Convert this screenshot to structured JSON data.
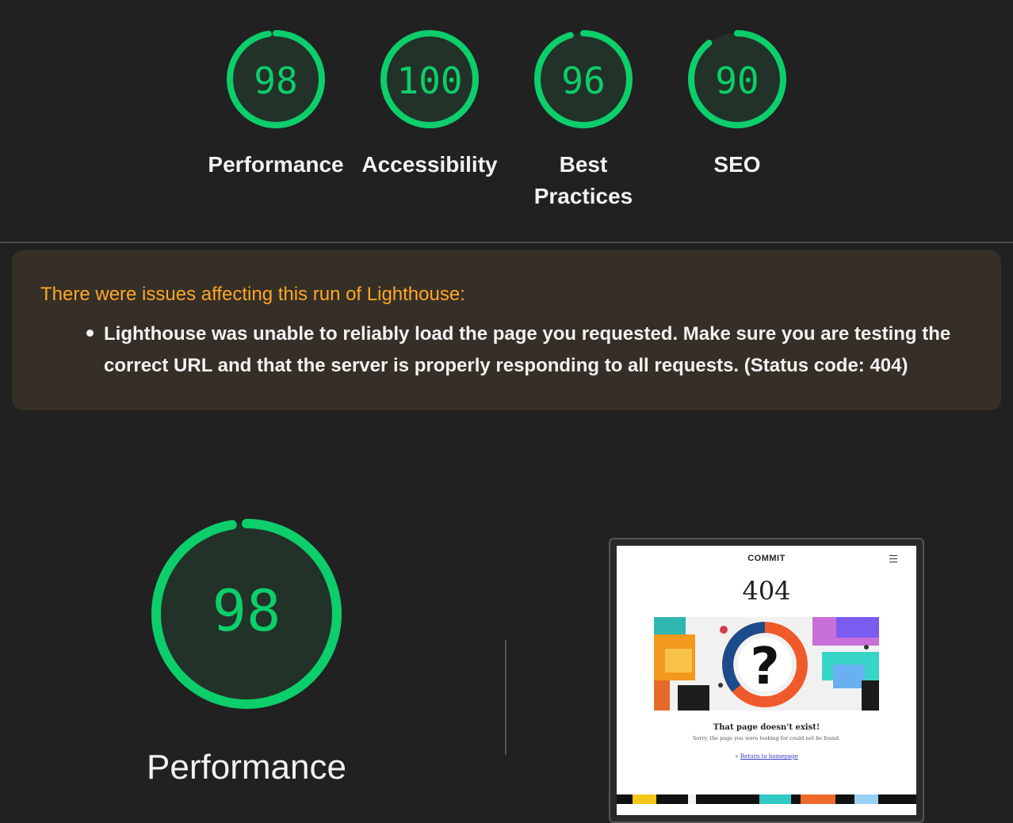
{
  "colors": {
    "pass": "#0cce6b",
    "pass_fill": "#233228",
    "warning": "#ffa726",
    "background": "#212121"
  },
  "gauges": [
    {
      "score": "98",
      "value": 98,
      "label_lines": [
        "Performance"
      ]
    },
    {
      "score": "100",
      "value": 100,
      "label_lines": [
        "Accessibility"
      ]
    },
    {
      "score": "96",
      "value": 96,
      "label_lines": [
        "Best",
        "Practices"
      ]
    },
    {
      "score": "90",
      "value": 90,
      "label_lines": [
        "SEO"
      ]
    }
  ],
  "warning": {
    "title": "There were issues affecting this run of Lighthouse:",
    "items": [
      "Lighthouse was unable to reliably load the page you requested. Make sure you are testing the correct URL and that the server is properly responding to all requests. (Status code: 404)"
    ]
  },
  "category": {
    "score": "98",
    "value": 98,
    "label": "Performance"
  },
  "screenshot": {
    "logo": "COMMIT",
    "code": "404",
    "heading": "That page doesn't exist!",
    "subtext": "Sorry, the page you were looking for could not be found.",
    "link_icon": "«",
    "link": "Return to homepage"
  }
}
